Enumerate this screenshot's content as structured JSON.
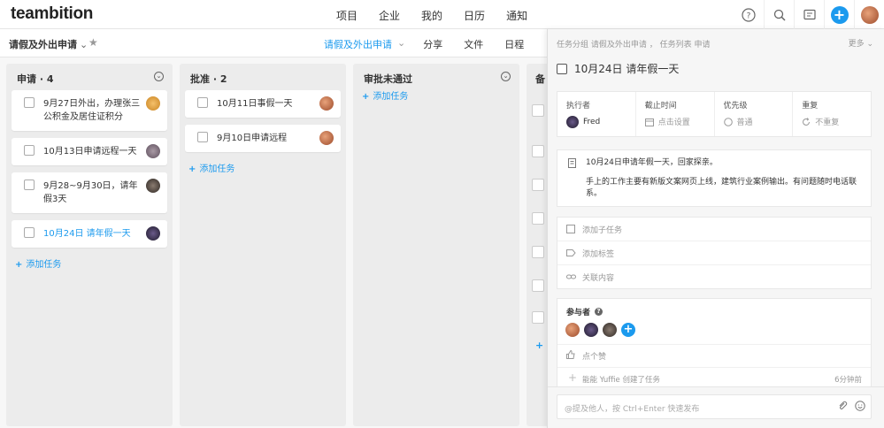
{
  "brand": "teambition",
  "top_nav": [
    "项目",
    "企业",
    "我的",
    "日历",
    "通知"
  ],
  "top_icons": [
    "help-icon",
    "search-icon",
    "chat-icon",
    "add-icon",
    "avatar"
  ],
  "project": {
    "title": "请假及外出申请",
    "views": [
      "请假及外出申请",
      "分享",
      "文件",
      "日程"
    ],
    "active_view": "请假及外出申请"
  },
  "columns": [
    {
      "title": "申请 · 4",
      "cards": [
        {
          "text": "9月27日外出，办理张三公积金及居住证积分",
          "highlight": false
        },
        {
          "text": "10月13日申请远程一天",
          "highlight": false
        },
        {
          "text": "9月28~9月30日，请年假3天",
          "highlight": false
        },
        {
          "text": "10月24日 请年假一天",
          "highlight": true
        }
      ],
      "add_label": "添加任务"
    },
    {
      "title": "批准 · 2",
      "cards": [
        {
          "text": "10月11日事假一天",
          "highlight": false
        },
        {
          "text": "9月10日申请远程",
          "highlight": false
        }
      ],
      "add_label": "添加任务"
    },
    {
      "title": "审批未通过",
      "cards": [],
      "add_label": "添加任务"
    },
    {
      "title": "备",
      "cards": [],
      "add_label": ""
    }
  ],
  "panel": {
    "breadcrumb": "任务分组 请假及外出申请 ， 任务列表 申请",
    "more": "更多",
    "task_title": "10月24日 请年假一天",
    "meta": {
      "assignee_label": "执行者",
      "assignee_value": "Fred",
      "due_label": "截止时间",
      "due_value": "点击设置",
      "priority_label": "优先级",
      "priority_value": "普通",
      "repeat_label": "重复",
      "repeat_value": "不重复"
    },
    "description": [
      "10月24日申请年假一天，回家探亲。",
      "手上的工作主要有新版文案网页上线，建筑行业案例输出。有问题随时电话联系。"
    ],
    "actions": [
      "添加子任务",
      "添加标签",
      "关联内容"
    ],
    "participants_label": "参与者",
    "like_label": "点个赞",
    "activity": "能能 Yuffie 创建了任务",
    "activity_time": "6分钟前",
    "comment_placeholder": "@提及他人，按 Ctrl+Enter 快速发布"
  },
  "colors": {
    "accent": "#1b9aee",
    "column_bg": "#ececec",
    "board_bg": "#f7f7f7"
  }
}
